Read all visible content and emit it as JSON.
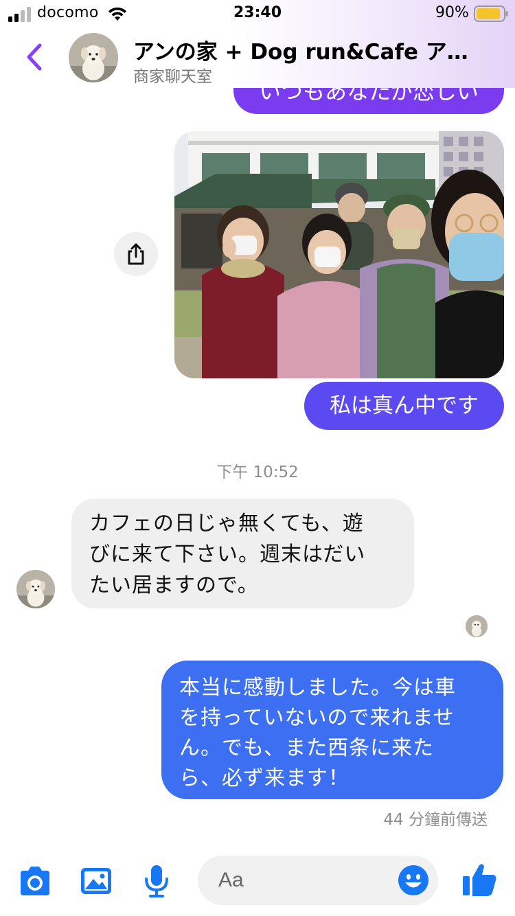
{
  "status_bar": {
    "carrier": "docomo",
    "time": "23:40",
    "battery_percent": "90%",
    "battery_level": 0.9,
    "icons": [
      "signal-icon",
      "wifi-icon",
      "battery-icon"
    ]
  },
  "header": {
    "title": "アンの家 + Dog run&Cafe ア…",
    "subtitle": "商家聊天室",
    "back_icon": "chevron-left-icon",
    "accent_color": "#8a3ffc"
  },
  "messages": {
    "outgoing_partial": "いつもあなたが恋しい",
    "photo_alt_icon": "photo-icon",
    "share_icon": "share-icon",
    "outgoing_caption": "私は真ん中です",
    "timestamp": "下午 10:52",
    "incoming_lines": [
      "カフェの日じゃ無くても、遊",
      "びに来て下さい。週末はだい",
      "たい居ますので。"
    ],
    "outgoing_last_lines": [
      "本当に感動しました。今は車",
      "を持っていないので来れませ",
      "ん。でも、また西条に来た",
      "ら、必ず来ます！"
    ],
    "sent_status": "44 分鐘前傳送"
  },
  "composer": {
    "placeholder": "Aa",
    "icons": [
      "camera-icon",
      "image-icon",
      "microphone-icon",
      "emoji-icon",
      "thumbs-up-icon"
    ],
    "icon_color": "#1877f2"
  },
  "colors": {
    "bubble_top": "#7b3cf0",
    "bubble_mid": "#5b4af2",
    "bubble_last": "#3d6ff2",
    "bubble_incoming": "#efefef"
  }
}
